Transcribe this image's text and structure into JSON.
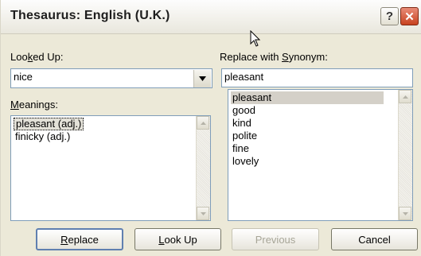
{
  "window": {
    "title": "Thesaurus: English (U.K.)"
  },
  "titlebar": {
    "help_glyph": "?",
    "close_glyph": "✕"
  },
  "looked_up": {
    "label_pre": "Loo",
    "label_key": "k",
    "label_post": "ed Up:",
    "value": "nice"
  },
  "meanings": {
    "label_key": "M",
    "label_post": "eanings:",
    "items": [
      "pleasant (adj.)",
      "finicky (adj.)"
    ],
    "selected_index": 0
  },
  "replace_with": {
    "label_pre": "Replace with ",
    "label_key": "S",
    "label_post": "ynonym:",
    "value": "pleasant",
    "items": [
      "pleasant",
      "good",
      "kind",
      "polite",
      "fine",
      "lovely"
    ],
    "selected_index": 0
  },
  "buttons": {
    "replace": {
      "key": "R",
      "rest": "eplace"
    },
    "look_up": {
      "key": "L",
      "rest": "ook Up"
    },
    "previous": "Previous",
    "cancel": "Cancel"
  },
  "icons": {
    "dropdown": "chevron-down-icon",
    "scroll_up": "triangle-up-icon",
    "scroll_down": "triangle-down-icon",
    "cursor": "mouse-pointer-icon"
  }
}
